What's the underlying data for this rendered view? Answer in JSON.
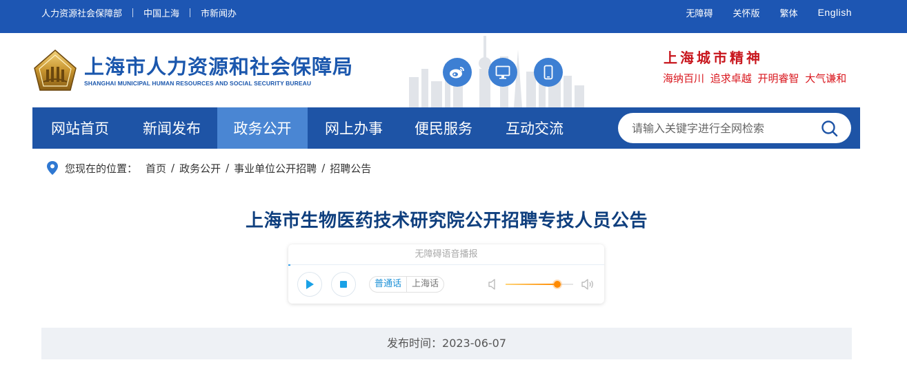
{
  "topbar": {
    "left_links": [
      "人力资源社会保障部",
      "中国上海",
      "市新闻办"
    ],
    "right_links": [
      "无障碍",
      "关怀版",
      "繁体",
      "English"
    ]
  },
  "header": {
    "site_name": "上海市人力资源和社会保障局",
    "site_name_en": "SHANGHAI MUNICIPAL HUMAN RESOURCES AND SOCIAL SECURITY BUREAU",
    "emblem_icon": "bureau-emblem-icon",
    "circle_icons": [
      "weibo-icon",
      "desktop-icon",
      "mobile-icon"
    ],
    "slogan_title": "上海城市精神",
    "slogan_text": "海纳百川 追求卓越 开明睿智 大气谦和"
  },
  "nav": {
    "items": [
      "网站首页",
      "新闻发布",
      "政务公开",
      "网上办事",
      "便民服务",
      "互动交流"
    ],
    "active_index": 2,
    "search_placeholder": "请输入关键字进行全网检索"
  },
  "breadcrumb": {
    "label": "您现在的位置：",
    "items": [
      "首页",
      "政务公开",
      "事业单位公开招聘",
      "招聘公告"
    ]
  },
  "article": {
    "title": "上海市生物医药技术研究院公开招聘专技人员公告",
    "publish_label": "发布时间：",
    "publish_date": "2023-06-07"
  },
  "audio_player": {
    "caption": "无障碍语音播报",
    "dialects": [
      "普通话",
      "上海话"
    ],
    "selected_dialect": "普通话",
    "volume_level": 0.77,
    "progress": 0.0
  },
  "colors": {
    "topbar": "#1d56b3",
    "nav": "#1e54a6",
    "nav_active": "#4a86d3",
    "title": "#0f3f7e",
    "slogan": "#c8161d"
  }
}
